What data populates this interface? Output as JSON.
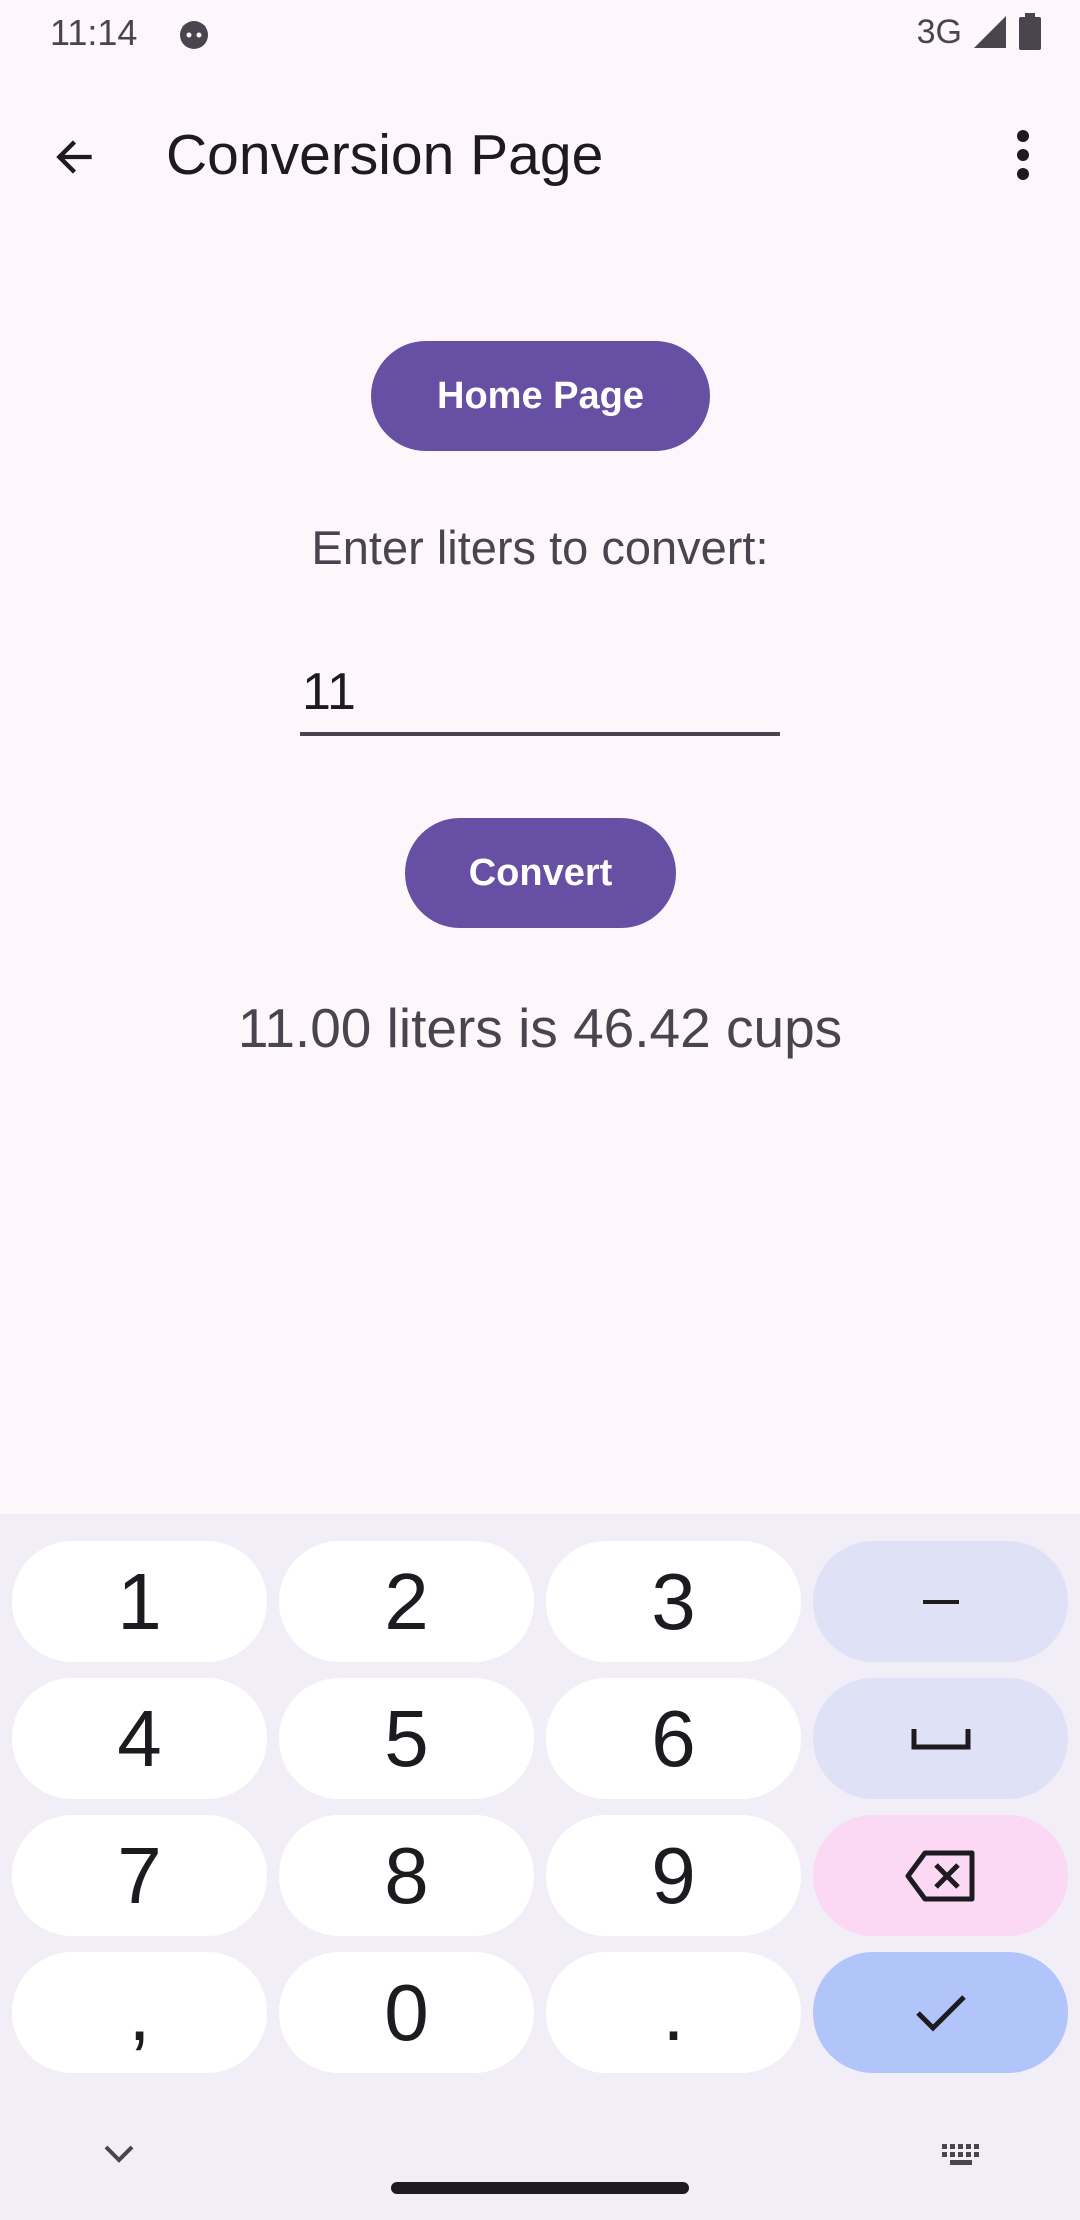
{
  "status_bar": {
    "time": "11:14",
    "network": "3G"
  },
  "app_bar": {
    "title": "Conversion Page"
  },
  "main": {
    "home_button": "Home Page",
    "prompt": "Enter liters to convert:",
    "input_value": "11",
    "convert_button": "Convert",
    "result": "11.00 liters is 46.42 cups"
  },
  "keyboard": {
    "keys": [
      "1",
      "2",
      "3",
      "–",
      "4",
      "5",
      "6",
      "␣",
      "7",
      "8",
      "9",
      "⌫",
      ",",
      "0",
      ".",
      "✓"
    ]
  },
  "colors": {
    "primary": "#6750a4",
    "background": "#fdf7fc",
    "keyboard_bg": "#f1eef7",
    "key_fn": "#dfe1f6",
    "key_delete": "#fbd9f5",
    "key_done": "#b1c5fb"
  }
}
